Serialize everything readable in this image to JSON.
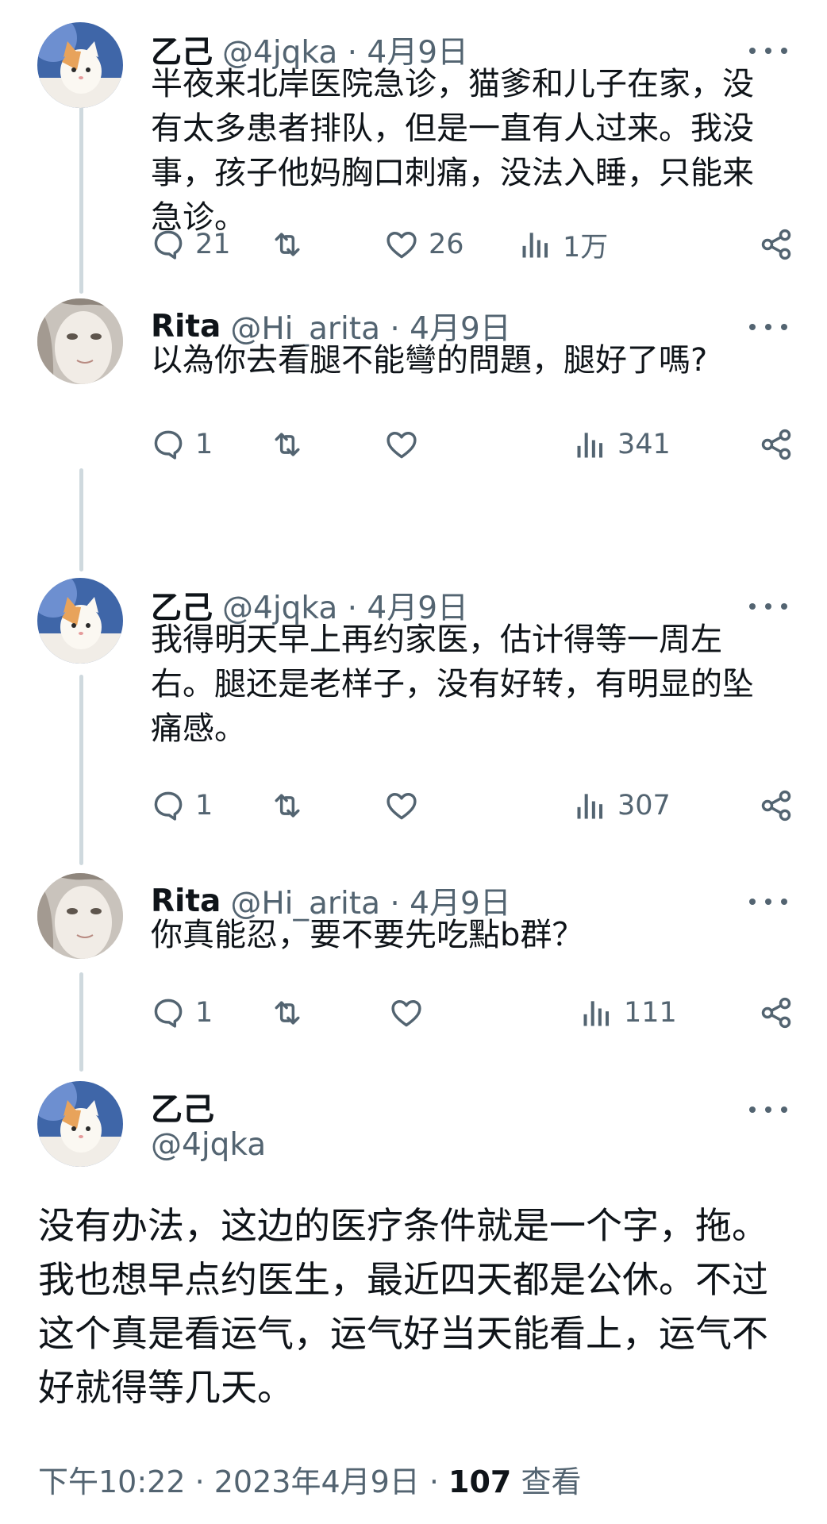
{
  "posts": [
    {
      "name": "乙己",
      "handle": "@4jqka · 4月9日",
      "text": "半夜来北岸医院急诊，猫爹和儿子在家，没有太多患者排队，但是一直有人过来。我没事，孩子他妈胸口刺痛，没法入睡，只能来急诊。",
      "replies": "21",
      "retweets": "",
      "likes": "26",
      "views": "1万"
    },
    {
      "name": "Rita",
      "handle": "@Hi_arita · 4月9日",
      "text": "以為你去看腿不能彎的問題，腿好了嗎?",
      "replies": "1",
      "retweets": "",
      "likes": "",
      "views": "341"
    },
    {
      "name": "乙己",
      "handle": "@4jqka · 4月9日",
      "text": "我得明天早上再约家医，估计得等一周左右。腿还是老样子，没有好转，有明显的坠痛感。",
      "replies": "1",
      "retweets": "",
      "likes": "",
      "views": "307"
    },
    {
      "name": "Rita",
      "handle": "@Hi_arita · 4月9日",
      "text": "你真能忍，要不要先吃點b群？",
      "replies": "1",
      "retweets": "",
      "likes": "",
      "views": "111"
    }
  ],
  "main_post": {
    "name": "乙己",
    "handle": "@4jqka",
    "text": "没有办法，这边的医疗条件就是一个字，拖。我也想早点约医生，最近四天都是公休。不过这个真是看运气，运气好当天能看上，运气不好就得等几天。",
    "timestamp": "下午10:22 · 2023年4月9日 · ",
    "view_count": "107",
    "view_label": " 查看"
  },
  "icons": {
    "reply": "reply-icon",
    "retweet": "retweet-icon",
    "like": "like-icon",
    "views": "views-icon",
    "share": "share-icon",
    "more": "more-icon"
  },
  "colors": {
    "text": "#0f1419",
    "secondary": "#536471",
    "thread_line": "#cfd9de"
  }
}
